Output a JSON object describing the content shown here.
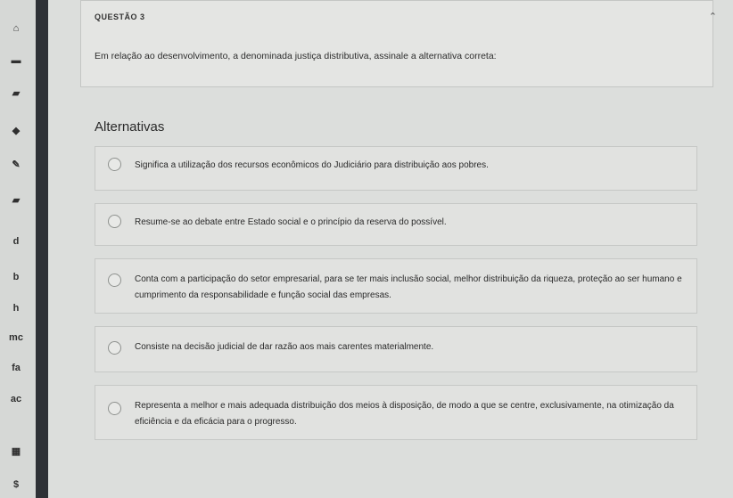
{
  "sidebar": {
    "icons": [
      "home-icon",
      "monitor-icon",
      "graduation-cap-icon",
      "diamond-icon",
      "pencil-icon",
      "graduation-cap-icon"
    ],
    "letters": [
      "d",
      "b",
      "h",
      "mc",
      "fa",
      "ac"
    ],
    "bottom_icons": [
      "cart-icon",
      "dollar-icon"
    ],
    "dollar": "$"
  },
  "question": {
    "title": "QUESTÃO 3",
    "text": "Em relação ao desenvolvimento, a denominada justiça distributiva, assinale a alternativa correta:"
  },
  "alternatives": {
    "heading": "Alternativas",
    "options": [
      "Significa a utilização dos recursos econômicos do Judiciário para distribuição aos pobres.",
      "Resume-se ao debate entre Estado social e o princípio da reserva do possível.",
      "Conta com a participação do setor empresarial, para se ter mais inclusão social, melhor distribuição da riqueza, proteção ao ser humano e cumprimento da responsabilidade e função social das empresas.",
      "Consiste na decisão judicial de dar razão aos mais carentes materialmente.",
      "Representa a melhor e mais adequada distribuição dos meios à disposição, de modo a que se centre, exclusivamente, na otimização da eficiência e da eficácia para o progresso."
    ]
  }
}
